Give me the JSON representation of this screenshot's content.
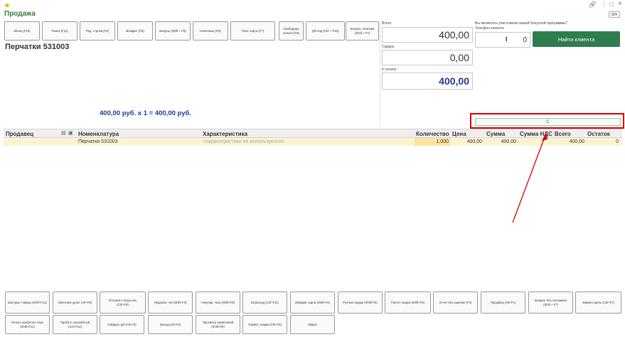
{
  "window": {
    "title": "Продажа"
  },
  "toolbar": {
    "buttons": [
      "Меню (F10)",
      "Поиск (F11)",
      "Ред. строки (F4)",
      "Возврат (F5)",
      "Бонусы (Shift + F5)",
      "Наличные (F6)",
      "Плат. карта (F7)",
      "Свободная оплата (F8)",
      "QR-код (Ctrl + F10)",
      "Безнал. платежи (Shift + F7)"
    ]
  },
  "product": {
    "name": "Перчатки 531003",
    "calc": "400,00 руб. x 1  = 400,00 руб."
  },
  "totals": {
    "total_label": "Всего:",
    "total_value": "400,00",
    "discount_label": "Скидка:",
    "discount_value": "0,00",
    "pay_label": "К оплате:",
    "pay_value": "400,00"
  },
  "client": {
    "question": "Вы являетесь участником нашей бонусной программы?",
    "phone_label": "Телефон клиента",
    "phone_value": "0",
    "find_button": "Найти клиента"
  },
  "status_field": {
    "value": "С"
  },
  "table": {
    "headers": [
      "Продавец",
      "Номенклатура",
      "Характеристика",
      "Количество",
      "Цена",
      "Сумма",
      "Сумма НДС",
      "Всего",
      "Остаток"
    ],
    "rows": [
      {
        "seller": "",
        "name": "Перчатки 531003",
        "characteristic": "<характеристики не используются>",
        "qty": "1,000",
        "price": "400,00",
        "sum": "400,00",
        "vat": "",
        "total": "400,00",
        "rest": "0"
      }
    ]
  },
  "bottom_row1": [
    "Быстрые товары (Shift+F12)",
    "Внесение денег (Alt+F8)",
    "Отложить текущ.чек (Ctrl+F9)",
    "Продолж. чек (Shift+F3)",
    "Аннулир. чека (Shift+F8)",
    "Штрихкод (Ctrl+F11)",
    "Информ. карта (Shift+F4)",
    "Ручные скидки (Shift+F5)",
    "Расчет скидок (Shift+F3)",
    "Отчет без гашения (F3)",
    "Продавец (Alt+F1)",
    "Возврат без основания (Shift + F7)",
    "Замена карты (Ctrl+F7)"
  ],
  "bottom_row2": [
    "Печать пробитого чека (Shift+F11)",
    "Пробить непробитый (Ctrl+F12)",
    "Ожидать ДЛ (Alt+F2)",
    "Выход (Alt+F3)",
    "Просмотр накоплений (Shift+F6)",
    "Управл. скидки (Ctrl+F5)",
    "Марки"
  ],
  "colors": {
    "accent": "#2e7d4f",
    "title": "#3a7a3a",
    "highlight_row": "#fdf3d0",
    "annotation": "#d40000",
    "blue_text": "#1f3a93"
  },
  "icons": [
    "star-icon",
    "link-icon",
    "more-icon",
    "restore-icon",
    "close-icon",
    "form-menu-icon"
  ]
}
